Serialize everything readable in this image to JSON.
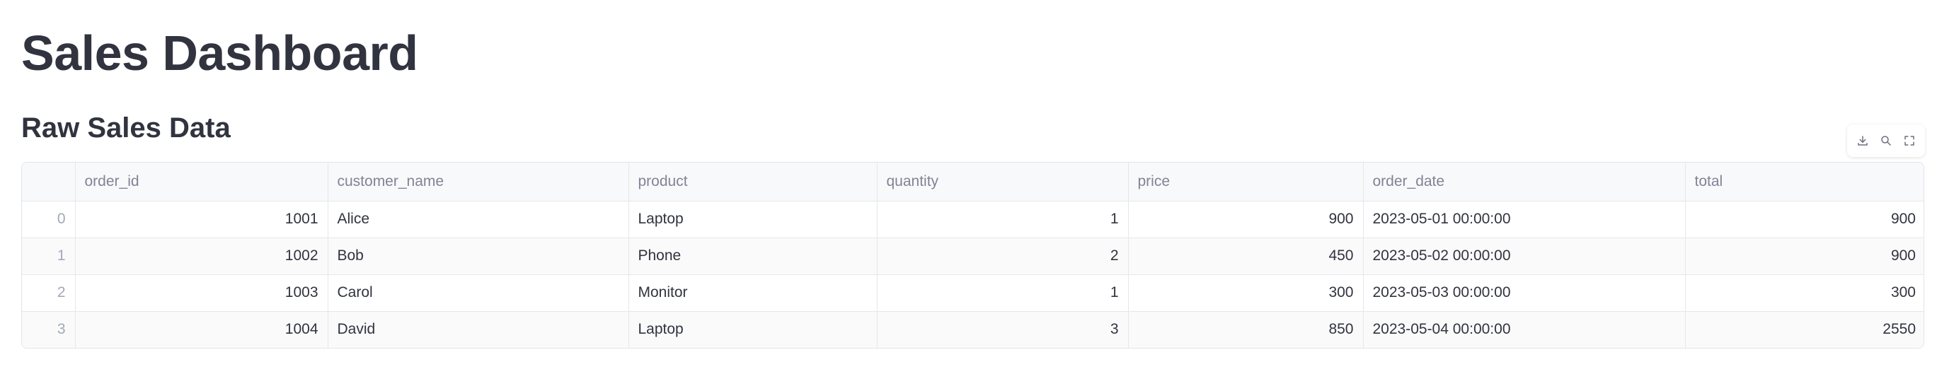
{
  "page": {
    "title": "Sales Dashboard",
    "subtitle": "Raw Sales Data"
  },
  "toolbar": {
    "icons": [
      "download-icon",
      "search-icon",
      "fullscreen-icon"
    ]
  },
  "table": {
    "columns": [
      "",
      "order_id",
      "customer_name",
      "product",
      "quantity",
      "price",
      "order_date",
      "total"
    ],
    "rows": [
      {
        "index": "0",
        "order_id": "1001",
        "customer_name": "Alice",
        "product": "Laptop",
        "quantity": "1",
        "price": "900",
        "order_date": "2023-05-01 00:00:00",
        "total": "900"
      },
      {
        "index": "1",
        "order_id": "1002",
        "customer_name": "Bob",
        "product": "Phone",
        "quantity": "2",
        "price": "450",
        "order_date": "2023-05-02 00:00:00",
        "total": "900"
      },
      {
        "index": "2",
        "order_id": "1003",
        "customer_name": "Carol",
        "product": "Monitor",
        "quantity": "1",
        "price": "300",
        "order_date": "2023-05-03 00:00:00",
        "total": "300"
      },
      {
        "index": "3",
        "order_id": "1004",
        "customer_name": "David",
        "product": "Laptop",
        "quantity": "3",
        "price": "850",
        "order_date": "2023-05-04 00:00:00",
        "total": "2550"
      }
    ]
  },
  "colors": {
    "text": "#31333f",
    "header_text": "#808495",
    "index_text": "#a3a8b8",
    "border": "#e6e7ea",
    "header_bg": "#f8f9fb"
  }
}
